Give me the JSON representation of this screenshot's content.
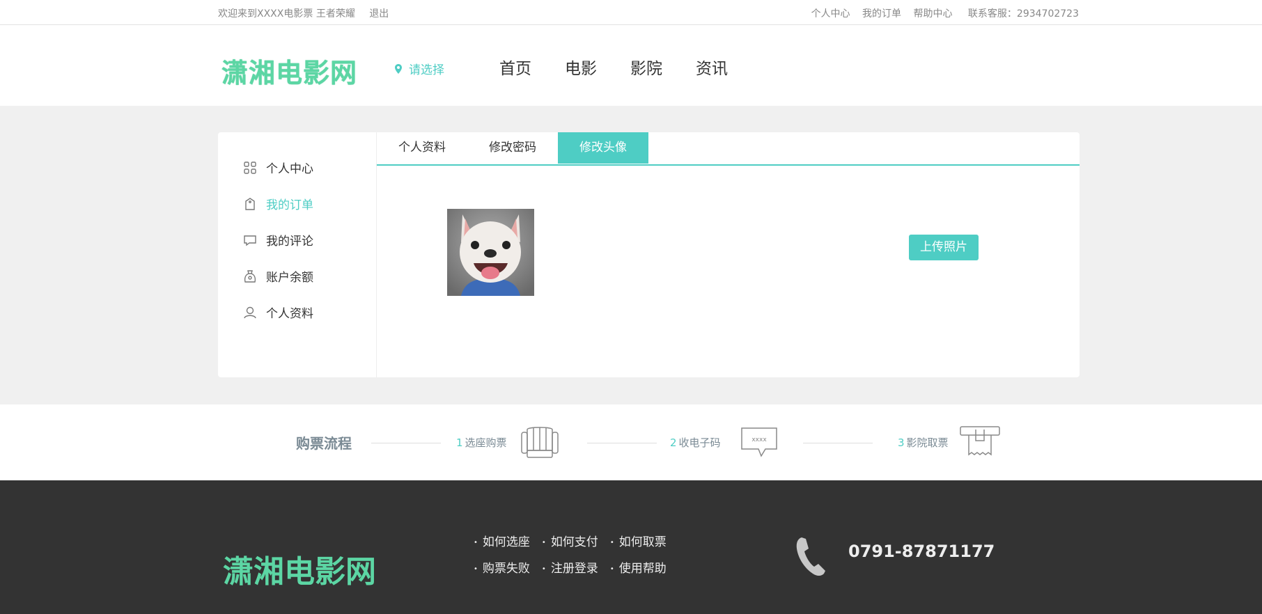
{
  "topbar": {
    "welcome": "欢迎来到XXXX电影票 王者荣耀",
    "logout": "退出",
    "links": [
      "个人中心",
      "我的订单",
      "帮助中心"
    ],
    "service": "联系客服：2934702723"
  },
  "header": {
    "logo": "潇湘电影网",
    "city": "请选择",
    "nav": [
      "首页",
      "电影",
      "影院",
      "资讯"
    ]
  },
  "sidebar": {
    "items": [
      {
        "label": "个人中心",
        "icon": "grid-icon",
        "active": false
      },
      {
        "label": "我的订单",
        "icon": "tag-icon",
        "active": true
      },
      {
        "label": "我的评论",
        "icon": "comment-icon",
        "active": false
      },
      {
        "label": "账户余额",
        "icon": "wallet-icon",
        "active": false
      },
      {
        "label": "个人资料",
        "icon": "user-icon",
        "active": false
      }
    ]
  },
  "tabs": [
    {
      "label": "个人资料",
      "active": false
    },
    {
      "label": "修改密码",
      "active": false
    },
    {
      "label": "修改头像",
      "active": true
    }
  ],
  "upload_label": "上传照片",
  "process": {
    "title": "购票流程",
    "steps": [
      {
        "num": "1",
        "label": "选座购票",
        "icon": "seat-icon"
      },
      {
        "num": "2",
        "label": "收电子码",
        "icon": "code-message-icon",
        "icon_text": "xxxx"
      },
      {
        "num": "3",
        "label": "影院取票",
        "icon": "ticket-machine-icon"
      }
    ]
  },
  "footer": {
    "logo": "潇湘电影网",
    "links_row1": [
      "如何选座",
      "如何支付",
      "如何取票"
    ],
    "links_row2": [
      "购票失败",
      "注册登录",
      "使用帮助"
    ],
    "phone": "0791-87871177"
  },
  "colors": {
    "accent": "#4ecdc4",
    "logo": "#5cd6a4",
    "footer_bg": "#333333"
  }
}
